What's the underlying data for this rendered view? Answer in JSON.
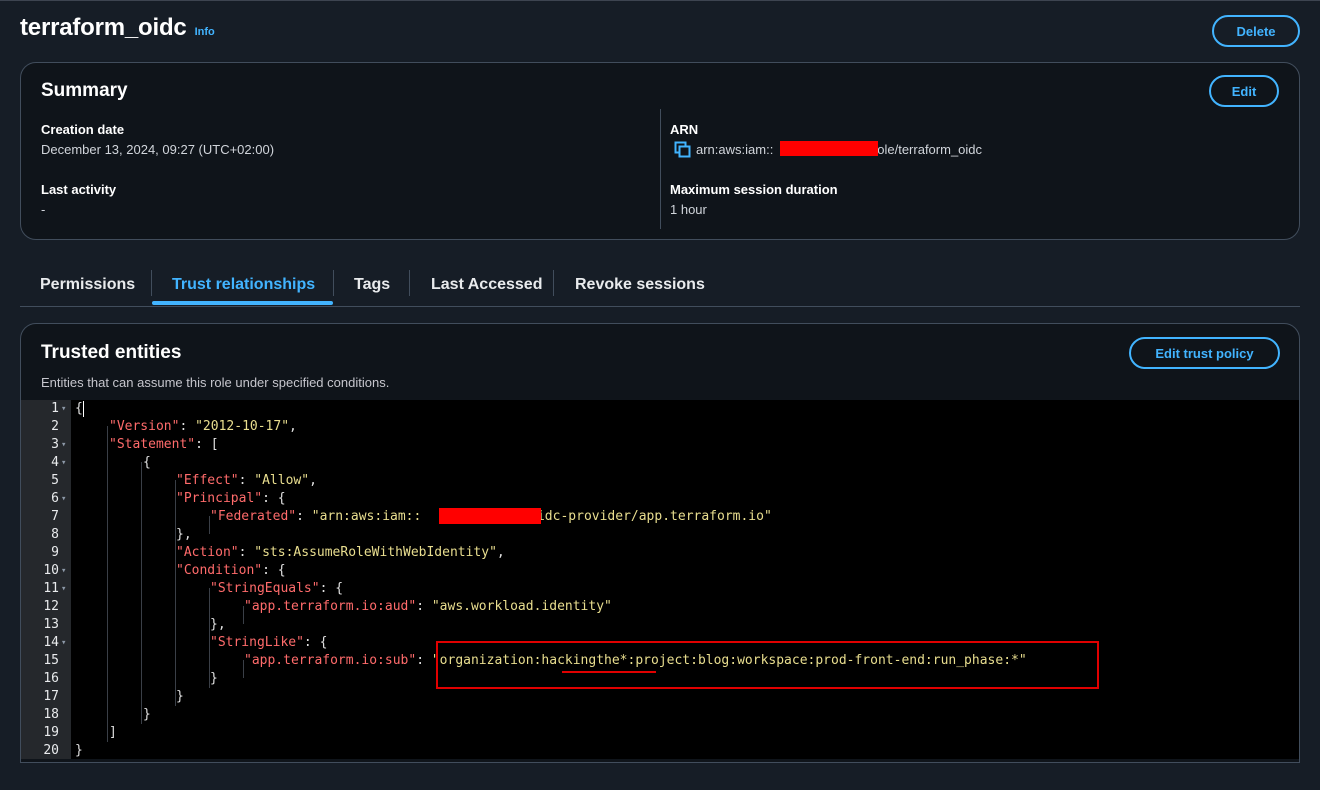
{
  "header": {
    "title": "terraform_oidc",
    "info_label": "Info",
    "delete_label": "Delete"
  },
  "summary": {
    "title": "Summary",
    "edit_label": "Edit",
    "creation_date_label": "Creation date",
    "creation_date_value": "December 13, 2024, 09:27 (UTC+02:00)",
    "last_activity_label": "Last activity",
    "last_activity_value": "-",
    "arn_label": "ARN",
    "arn_prefix": "arn:aws:iam::",
    "arn_suffix": ":role/terraform_oidc",
    "max_session_label": "Maximum session duration",
    "max_session_value": "1 hour"
  },
  "tabs": [
    {
      "label": "Permissions"
    },
    {
      "label": "Trust relationships",
      "active": true
    },
    {
      "label": "Tags"
    },
    {
      "label": "Last Accessed"
    },
    {
      "label": "Revoke sessions"
    }
  ],
  "trusted": {
    "title": "Trusted entities",
    "subtitle": "Entities that can assume this role under specified conditions.",
    "edit_label": "Edit trust policy"
  },
  "policy": {
    "line_numbers": [
      "1",
      "2",
      "3",
      "4",
      "5",
      "6",
      "7",
      "8",
      "9",
      "10",
      "11",
      "12",
      "13",
      "14",
      "15",
      "16",
      "17",
      "18",
      "19",
      "20"
    ],
    "version_key": "\"Version\"",
    "version_value": "\"2012-10-17\"",
    "statement_key": "\"Statement\"",
    "effect_key": "\"Effect\"",
    "effect_value": "\"Allow\"",
    "principal_key": "\"Principal\"",
    "federated_key": "\"Federated\"",
    "federated_value_prefix": "\"arn:aws:iam::",
    "federated_value_suffix": ":oidc-provider/app.terraform.io\"",
    "action_key": "\"Action\"",
    "action_value": "\"sts:AssumeRoleWithWebIdentity\"",
    "condition_key": "\"Condition\"",
    "string_equals_key": "\"StringEquals\"",
    "aud_key": "\"app.terraform.io:aud\"",
    "aud_value": "\"aws.workload.identity\"",
    "string_like_key": "\"StringLike\"",
    "sub_key": "\"app.terraform.io:sub\"",
    "sub_value": "\"organization:hackingthe*:project:blog:workspace:prod-front-end:run_phase:*\""
  },
  "colors": {
    "accent": "#42b4ff",
    "json_key": "#ff6b6b",
    "json_string": "#e9de8f",
    "highlight": "#e00000",
    "redaction": "#ff0000"
  }
}
